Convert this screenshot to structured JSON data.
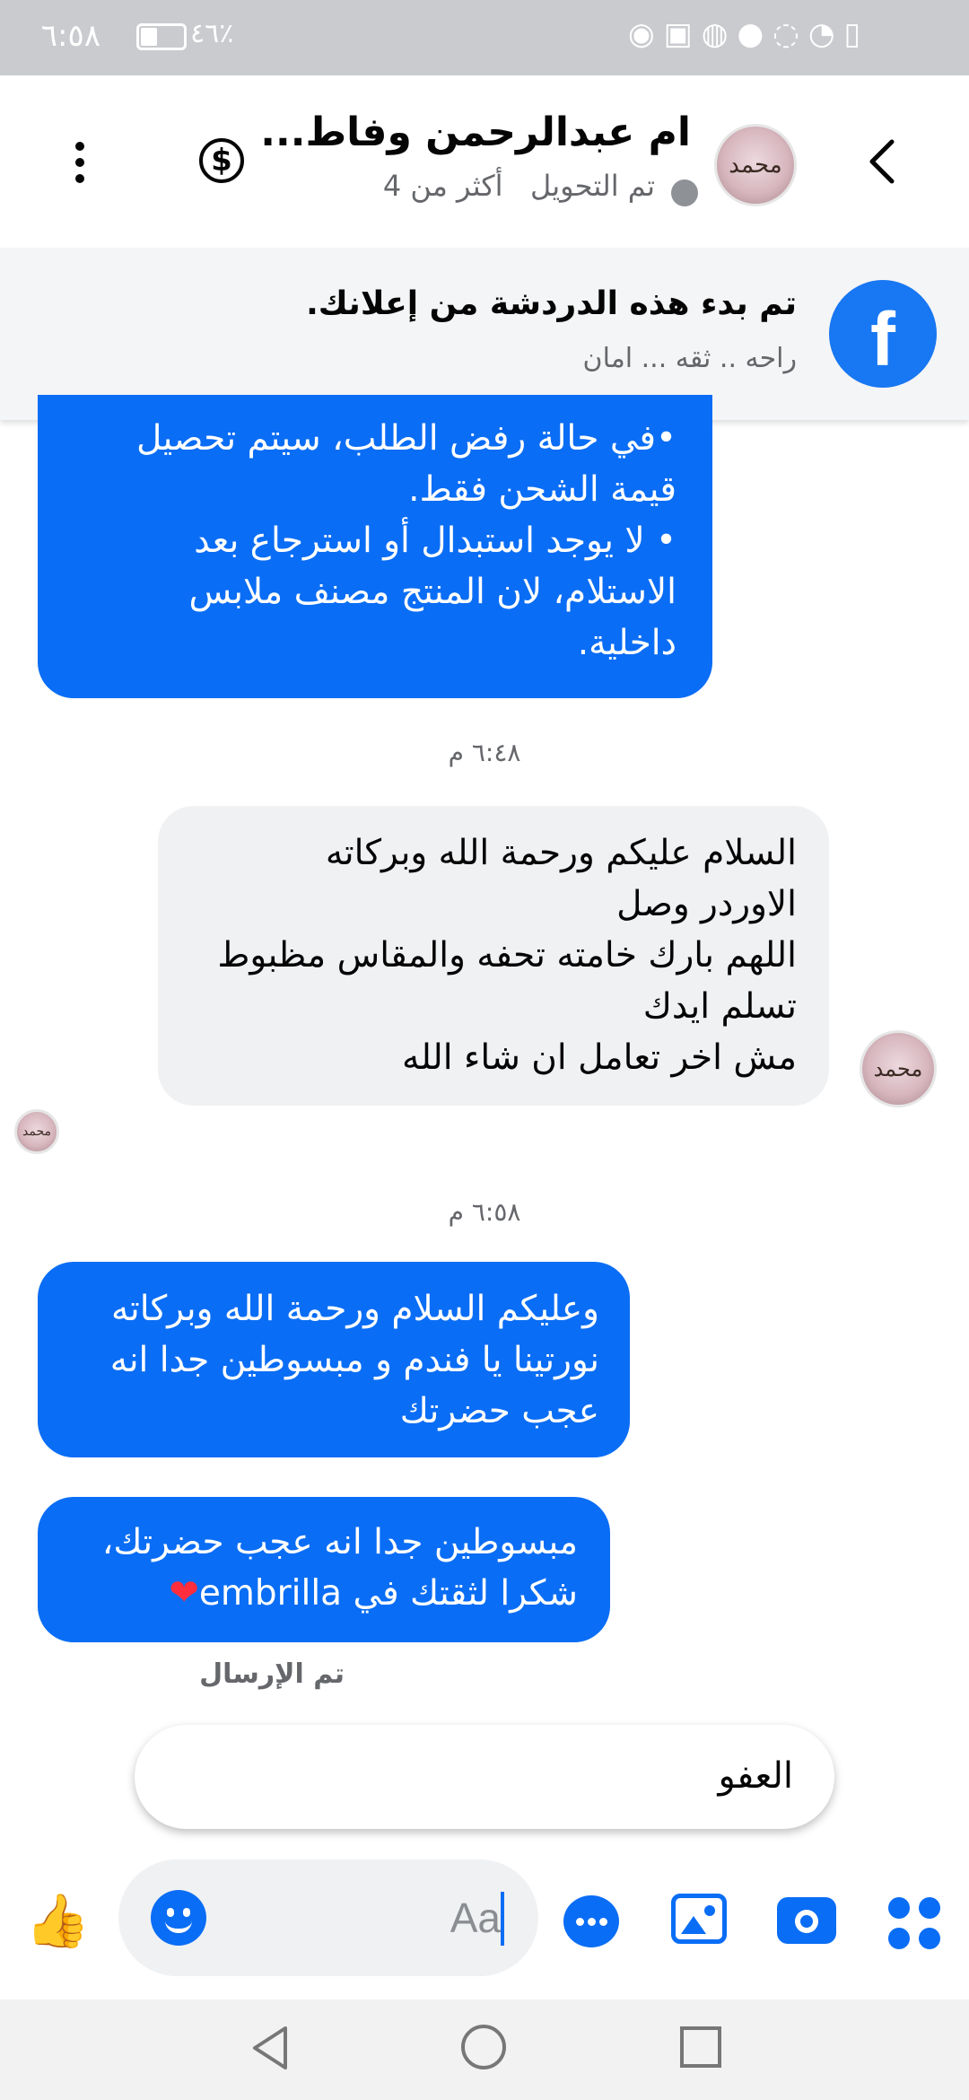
{
  "status_bar": {
    "time": "٦:٥٨",
    "battery": "٤٦٪",
    "icons": [
      "snapchat-icon",
      "instagram-icon",
      "photo-icon",
      "facebook-icon",
      "whatsapp-icon",
      "wifi-icon",
      "alert-icon"
    ]
  },
  "header": {
    "title": "ام عبدالرحمن وفاط...",
    "status_text": "تم التحويل",
    "status_detail": "أكثر من 4",
    "avatar_text": "محمد"
  },
  "ad_banner": {
    "title": "تم بدء هذه الدردشة من إعلانك.",
    "subtitle": "راحه .. ثقه ... امان"
  },
  "messages": [
    {
      "type": "out",
      "text": "•في حالة رفض الطلب، سيتم تحصيل\nقيمة الشحن فقط.\n• لا يوجد استبدال أو استرجاع بعد\nالاستلام، لان المنتج مصنف ملابس\nداخلية."
    },
    {
      "type": "time",
      "text": "٦:٤٨ م"
    },
    {
      "type": "in",
      "text": "السلام عليكم ورحمة الله وبركاته\nالاوردر وصل\nاللهم بارك خامته تحفه والمقاس مظبوط\nتسلم ايدك\nمش اخر تعامل ان شاء الله"
    },
    {
      "type": "time",
      "text": "٦:٥٨ م"
    },
    {
      "type": "out",
      "text": "وعليكم السلام ورحمة الله وبركاته\nنورتينا يا فندم و مبسوطين جدا انه\nعجب حضرتك"
    },
    {
      "type": "out",
      "text": "مبسوطين جدا انه عجب حضرتك،\nشكرا لثقتك في embrilla"
    }
  ],
  "heart": "❤",
  "sent_status": "تم الإرسال",
  "quick_reply": "العفو",
  "composer": {
    "placeholder": "Aa"
  },
  "colors": {
    "accent": "#0a6df5",
    "incoming_bubble": "#f0f1f3",
    "facebook_blue": "#1877f2"
  }
}
